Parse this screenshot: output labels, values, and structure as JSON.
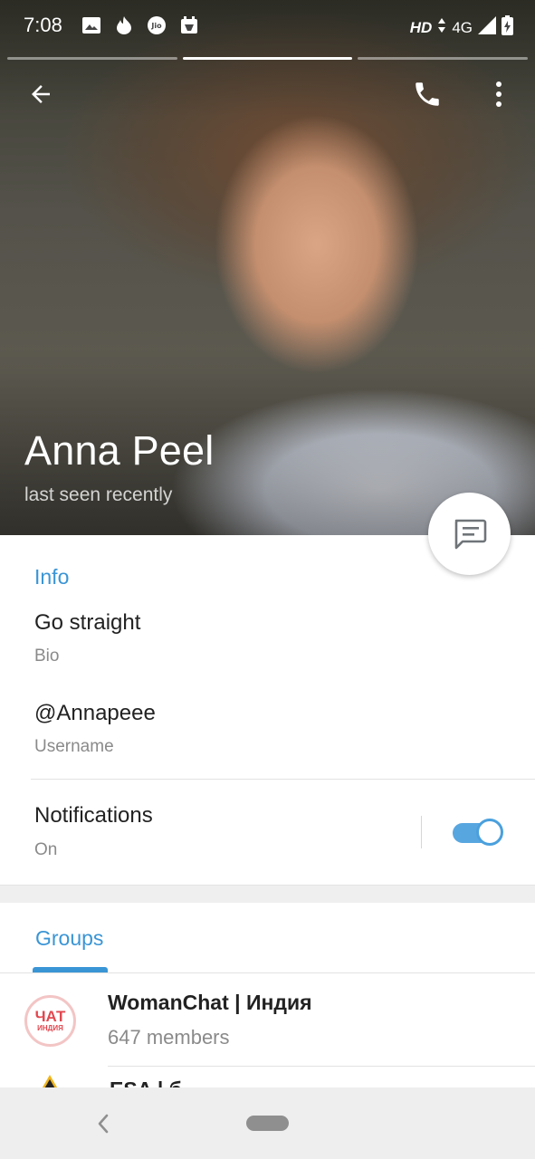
{
  "status_bar": {
    "time": "7:08",
    "hd": "HD",
    "network": "4G"
  },
  "story": {
    "segments": 3,
    "active_segment": 2
  },
  "profile": {
    "name": "Anna Peel",
    "status": "last seen recently"
  },
  "info": {
    "section_title": "Info",
    "bio_value": "Go straight",
    "bio_label": "Bio",
    "username_value": "@Annapeee",
    "username_label": "Username",
    "notifications_title": "Notifications",
    "notifications_value": "On",
    "notifications_enabled": true
  },
  "groups": {
    "tab_label": "Groups",
    "items": [
      {
        "name": "WomanChat | Индия",
        "members": "647 members",
        "avatar_main": "ЧАТ",
        "avatar_sub": "ИНДИЯ"
      },
      {
        "name": "ESA | б"
      }
    ]
  },
  "colors": {
    "accent": "#3a95d5",
    "toggle_on": "#58a6e0"
  },
  "icons": {
    "back": "arrow-left-icon",
    "call": "phone-icon",
    "more": "more-vertical-icon",
    "message": "message-icon"
  }
}
